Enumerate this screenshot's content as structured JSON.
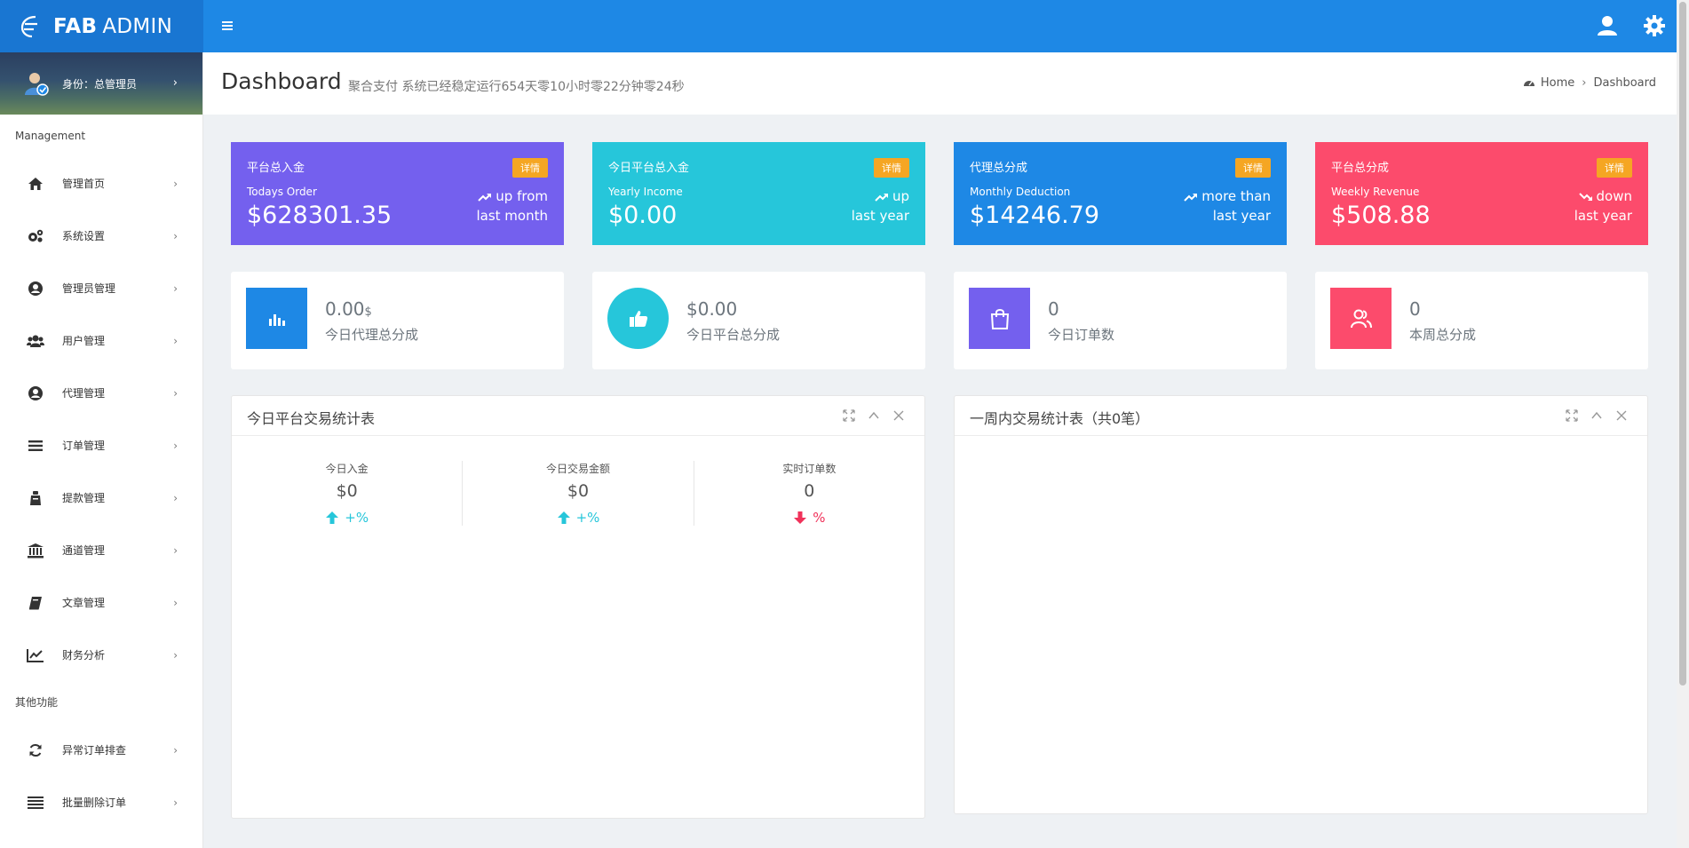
{
  "brand": {
    "bold": "FAB",
    "light": "ADMIN"
  },
  "profile": {
    "label": "身份：总管理员"
  },
  "sidebar": {
    "section_main": "Management",
    "items": [
      {
        "label": "管理首页",
        "icon": "home-icon"
      },
      {
        "label": "系统设置",
        "icon": "cogs-icon"
      },
      {
        "label": "管理员管理",
        "icon": "user-circle-icon"
      },
      {
        "label": "用户管理",
        "icon": "users-icon"
      },
      {
        "label": "代理管理",
        "icon": "user-circle-icon"
      },
      {
        "label": "订单管理",
        "icon": "list-icon"
      },
      {
        "label": "提款管理",
        "icon": "bag-icon"
      },
      {
        "label": "通道管理",
        "icon": "bank-icon"
      },
      {
        "label": "文章管理",
        "icon": "book-icon"
      },
      {
        "label": "财务分析",
        "icon": "line-chart-icon"
      }
    ],
    "section_other": "其他功能",
    "other_items": [
      {
        "label": "异常订单排查",
        "icon": "refresh-icon"
      },
      {
        "label": "批量删除订单",
        "icon": "bars-icon"
      }
    ]
  },
  "header": {
    "title": "Dashboard",
    "subtitle": "聚合支付 系统已经稳定运行654天零10小时零22分钟零24秒",
    "breadcrumb": {
      "home": "Home",
      "current": "Dashboard"
    }
  },
  "color_cards": [
    {
      "title": "平台总入金",
      "subtitle": "Todays Order",
      "value": "$628301.35",
      "badge": "详情",
      "trend_line1": "up from",
      "trend_line2": "last month",
      "trend": "up",
      "color": "#7460ee"
    },
    {
      "title": "今日平台总入金",
      "subtitle": "Yearly Income",
      "value": "$0.00",
      "badge": "详情",
      "trend_line1": "up",
      "trend_line2": "last year",
      "trend": "up",
      "color": "#26c6da"
    },
    {
      "title": "代理总分成",
      "subtitle": "Monthly Deduction",
      "value": "$14246.79",
      "badge": "详情",
      "trend_line1": "more than",
      "trend_line2": "last year",
      "trend": "up",
      "color": "#1e88e5"
    },
    {
      "title": "平台总分成",
      "subtitle": "Weekly Revenue",
      "value": "$508.88",
      "badge": "详情",
      "trend_line1": "down",
      "trend_line2": "last year",
      "trend": "down",
      "color": "#fc4b6c"
    }
  ],
  "mini_cards": [
    {
      "value": "0.00",
      "unit": "$",
      "label": "今日代理总分成",
      "icon": "bar-chart-icon",
      "color": "#1e88e5"
    },
    {
      "value": "$0.00",
      "unit": "",
      "label": "今日平台总分成",
      "icon": "thumbs-up-icon",
      "color": "#26c6da"
    },
    {
      "value": "0",
      "unit": "",
      "label": "今日订单数",
      "icon": "shopping-bag-icon",
      "color": "#7460ee"
    },
    {
      "value": "0",
      "unit": "",
      "label": "本周总分成",
      "icon": "users-icon",
      "color": "#fc4b6c"
    }
  ],
  "panel_today": {
    "title": "今日平台交易统计表",
    "stats": [
      {
        "label": "今日入金",
        "value": "$0",
        "change": "+%",
        "dir": "up"
      },
      {
        "label": "今日交易金额",
        "value": "$0",
        "change": "+%",
        "dir": "up"
      },
      {
        "label": "实时订单数",
        "value": "0",
        "change": "%",
        "dir": "down"
      }
    ]
  },
  "panel_week": {
    "title": "一周内交易统计表（共0笔）"
  },
  "colors": {
    "topbar": "#1e88e5",
    "up": "#26c6da",
    "down": "#f0325a"
  }
}
